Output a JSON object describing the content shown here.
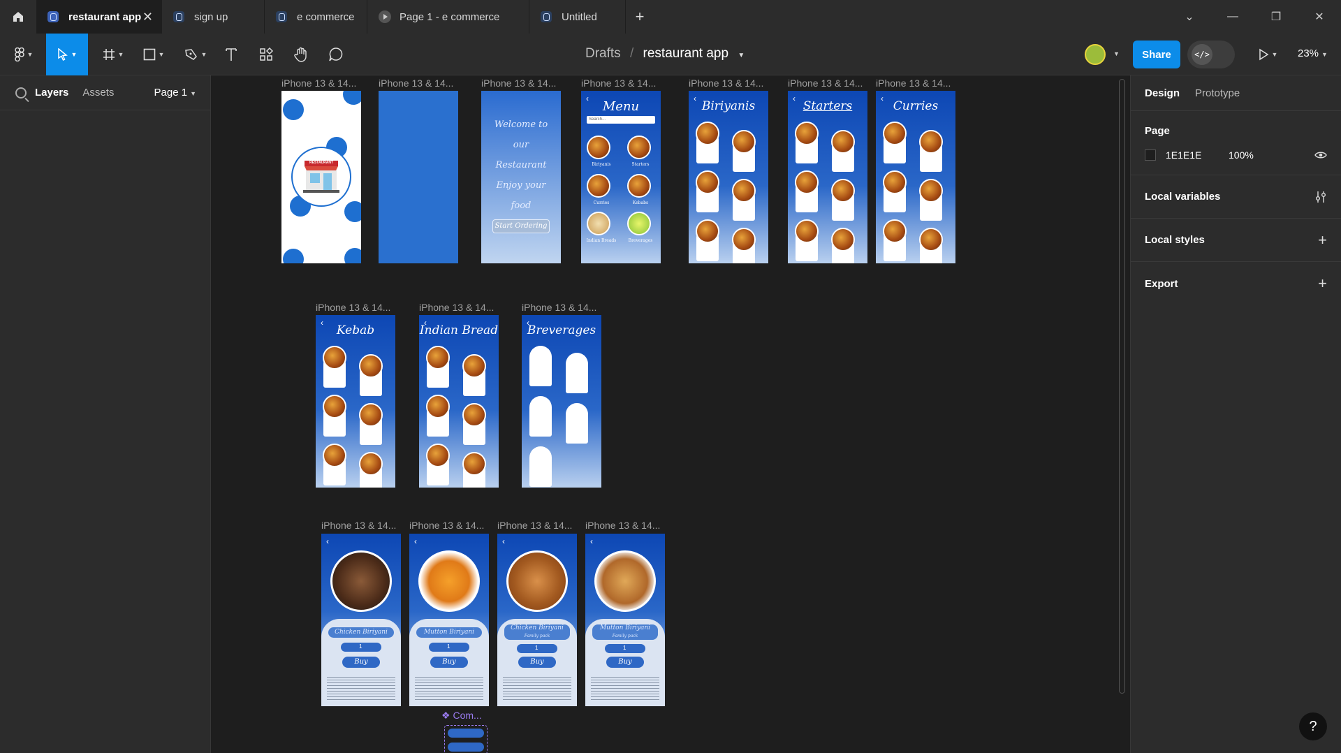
{
  "tabs": [
    {
      "label": "restaurant app",
      "active": true
    },
    {
      "label": "sign up"
    },
    {
      "label": "e commerce"
    },
    {
      "label": "Page 1 - e commerce",
      "kind": "prototype"
    },
    {
      "label": "Untitled"
    }
  ],
  "toolbar": {
    "breadcrumb_parent": "Drafts",
    "breadcrumb_sep": "/",
    "file_name": "restaurant app",
    "share_label": "Share",
    "zoom": "23%"
  },
  "left_panel": {
    "tab_layers": "Layers",
    "tab_assets": "Assets",
    "page_selector": "Page 1"
  },
  "right_panel": {
    "tab_design": "Design",
    "tab_prototype": "Prototype",
    "page_heading": "Page",
    "page_color": "1E1E1E",
    "page_color_hex": "#1E1E1E",
    "page_opacity": "100%",
    "local_variables": "Local variables",
    "local_styles": "Local styles",
    "export": "Export"
  },
  "canvas": {
    "frame_label": "iPhone 13 & 14...",
    "component_label": "Com...",
    "menu": {
      "title": "Menu",
      "search": "Search...",
      "items": [
        "Biriyanis",
        "Starters",
        "Curries",
        "Kebabs",
        "Indian Breads",
        "Breverages"
      ]
    },
    "welcome": {
      "text": "Welcome to our Restaurant Enjoy your food",
      "button": "Start Ordering"
    },
    "category_titles": [
      "Biriyanis",
      "Starters",
      "Curries",
      "Kebab",
      "Indian Bread",
      "Breverages"
    ],
    "detail": [
      {
        "name": "Chicken Biriyani",
        "qty": "1",
        "buy": "Buy"
      },
      {
        "name": "Mutton Biriyani",
        "qty": "1",
        "buy": "Buy"
      },
      {
        "name": "Chicken Biriyani",
        "sub": "Family pack",
        "qty": "1",
        "buy": "Buy"
      },
      {
        "name": "Mutton Biriyani",
        "sub": "Family pack",
        "qty": "1",
        "buy": "Buy"
      }
    ],
    "splash_sign": "RESTAURANT"
  },
  "colors": {
    "accent": "#0c8ce9",
    "frame_blue": "#0d47b4",
    "canvas_bg": "#1e1e1e",
    "panel_bg": "#2c2c2c"
  }
}
